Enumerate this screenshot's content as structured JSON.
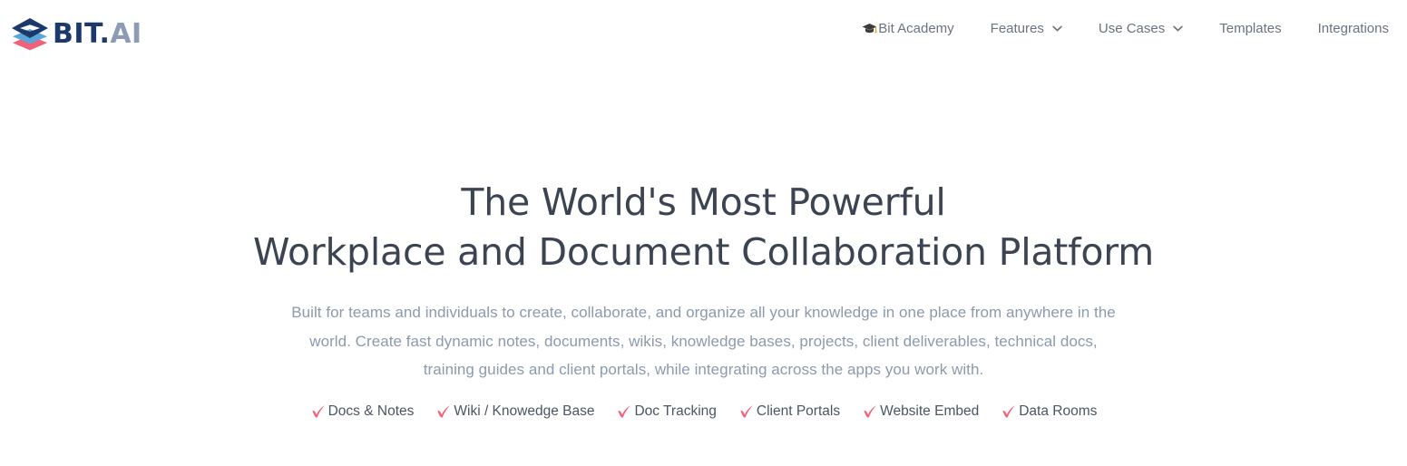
{
  "brand": {
    "name_primary": "BIT",
    "name_dot": ".",
    "name_secondary": "AI",
    "logo_colors": {
      "top_diamond": "#1b3a6b",
      "mid_diamond": "#5aa6d8",
      "bottom_diamond": "#f4607a"
    }
  },
  "nav": {
    "items": [
      {
        "label": "Bit Academy",
        "icon": "graduation-cap-icon",
        "has_caret": false
      },
      {
        "label": "Features",
        "icon": null,
        "has_caret": true
      },
      {
        "label": "Use Cases",
        "icon": null,
        "has_caret": true
      },
      {
        "label": "Templates",
        "icon": null,
        "has_caret": false
      },
      {
        "label": "Integrations",
        "icon": null,
        "has_caret": false
      }
    ]
  },
  "hero": {
    "title_line_1": "The World's Most Powerful",
    "title_line_2": "Workplace and Document Collaboration Platform",
    "subtitle": "Built for teams and individuals to create, collaborate, and organize all your knowledge in one place from anywhere in the world. Create fast dynamic notes, documents, wikis, knowledge bases, projects, client deliverables, technical docs, training guides and client portals, while integrating across the apps you work with.",
    "features": [
      {
        "label": "Docs & Notes"
      },
      {
        "label": "Wiki / Knowedge Base"
      },
      {
        "label": "Doc Tracking"
      },
      {
        "label": "Client Portals"
      },
      {
        "label": "Website Embed"
      },
      {
        "label": "Data Rooms"
      }
    ],
    "feature_check_color": "#f4607a",
    "title_color": "#3d4451",
    "subtitle_color": "#8d99ad"
  }
}
